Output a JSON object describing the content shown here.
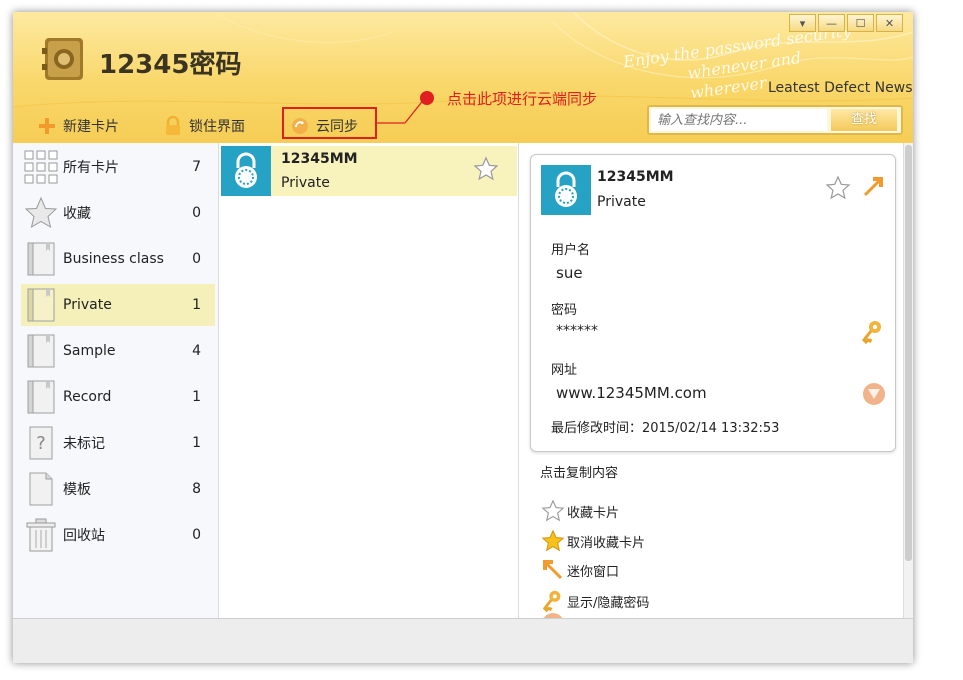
{
  "app": {
    "title": "12345密码",
    "slogan_line1": "Enjoy the password security",
    "slogan_line2": "whenever and wherever",
    "news_link": "Leatest Defect News"
  },
  "window_controls": {
    "menu": "▾",
    "minimize": "—",
    "maximize": "☐",
    "close": "✕"
  },
  "toolbar": {
    "new_card": "新建卡片",
    "lock_ui": "锁住界面",
    "cloud_sync": "云同步",
    "callout": "点击此项进行云端同步"
  },
  "search": {
    "placeholder": "输入查找内容...",
    "button": "查找"
  },
  "sidebar": {
    "items": [
      {
        "label": "所有卡片",
        "count": "7"
      },
      {
        "label": "收藏",
        "count": "0"
      },
      {
        "label": "Business class",
        "count": "0"
      },
      {
        "label": "Private",
        "count": "1"
      },
      {
        "label": "Sample",
        "count": "4"
      },
      {
        "label": "Record",
        "count": "1"
      },
      {
        "label": "未标记",
        "count": "1"
      },
      {
        "label": "模板",
        "count": "8"
      },
      {
        "label": "回收站",
        "count": "0"
      }
    ]
  },
  "list": {
    "card": {
      "name": "12345MM",
      "category": "Private"
    }
  },
  "detail": {
    "name": "12345MM",
    "category": "Private",
    "username_label": "用户名",
    "username": "sue",
    "password_label": "密码",
    "password": "******",
    "url_label": "网址",
    "url": "www.12345MM.com",
    "modified": "最后修改时间：2015/02/14 13:32:53",
    "copy_hint": "点击复制内容",
    "actions": {
      "favorite": "收藏卡片",
      "unfavorite": "取消收藏卡片",
      "mini_window": "迷你窗口",
      "toggle_password": "显示/隐藏密码"
    }
  },
  "colors": {
    "header": "#f9d76a",
    "accent_lock": "#26a2c4",
    "selected_row": "#f8f2bd",
    "callout": "#e02020"
  }
}
